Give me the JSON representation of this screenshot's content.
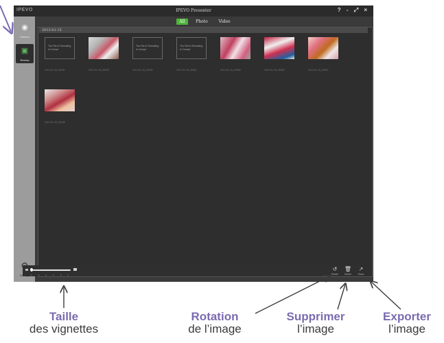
{
  "app": {
    "logo": "IPEVO",
    "title": "IPEVO Presenter",
    "window_controls": "? - ⤢ ×"
  },
  "sidebar": {
    "items": [
      {
        "label": "Camera",
        "icon": "location-pin-icon"
      },
      {
        "label": "Review",
        "icon": "image-icon"
      },
      {
        "label": "Settings",
        "icon": "gear-icon"
      }
    ]
  },
  "filter_tabs": [
    {
      "label": "All",
      "active": true
    },
    {
      "label": "Photo",
      "active": false
    },
    {
      "label": "Video",
      "active": false
    }
  ],
  "date_group": "2013-01-15",
  "thumbnails": [
    {
      "type": "placeholder",
      "text": "The File in Shredding is Corrupt",
      "caption": "2013-01-15_00001"
    },
    {
      "type": "photo",
      "style": "photo-a",
      "caption": "2013-01-15_00003"
    },
    {
      "type": "placeholder",
      "text": "The File in Shredding is Corrupt",
      "caption": "2013-01-15_00002"
    },
    {
      "type": "placeholder",
      "text": "The File in Shredding is Corrupt",
      "caption": "2013-01-15_00004"
    },
    {
      "type": "photo",
      "style": "photo-b",
      "caption": "2013-01-15_00005"
    },
    {
      "type": "photo",
      "style": "photo-c",
      "caption": "2013-01-15_00006"
    },
    {
      "type": "photo",
      "style": "photo-d",
      "caption": "2013-01-15_00007"
    },
    {
      "type": "photo",
      "style": "photo-e",
      "caption": "2013-01-15_00008"
    }
  ],
  "toolbar": {
    "rotate_label": "Rotate",
    "delete_label": "Delete",
    "share_label": "Share"
  },
  "annotations": {
    "size": {
      "title": "Taille",
      "desc": "des vignettes"
    },
    "rotate": {
      "title": "Rotation",
      "desc": "de l’image"
    },
    "delete": {
      "title": "Supprimer",
      "desc": "l’image"
    },
    "export": {
      "title": "Exporter",
      "desc": "l’image"
    }
  },
  "colors": {
    "accent_green": "#4fb33b",
    "annotation_purple": "#7b6bb0",
    "app_background": "#3a3a3a",
    "sidebar_gray": "#9c9c9c"
  }
}
